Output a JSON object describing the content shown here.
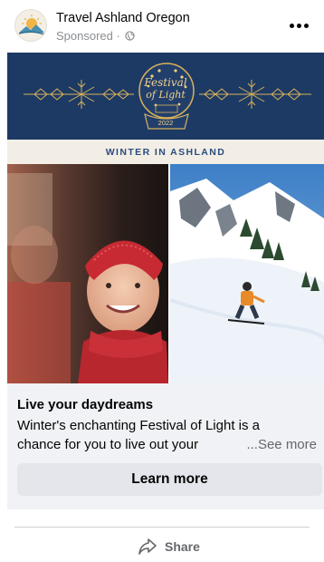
{
  "post": {
    "page_name": "Travel Ashland Oregon",
    "sponsored_label": "Sponsored ·",
    "colors": {
      "banner_navy": "#1d3a64",
      "band_cream": "#f2eee5",
      "band_text": "#2b4c7e",
      "gold": "#d9b25c"
    }
  },
  "creative": {
    "logo": {
      "line1": "Festival",
      "line2": "of Light",
      "year": "2022"
    },
    "band_text": "WINTER IN ASHLAND"
  },
  "caption": {
    "headline": "Live your daydreams",
    "desc_line1": "Winter's enchanting Festival of Light is a",
    "desc_line2": "chance for you to live out your",
    "see_more": "...See more",
    "cta": "Learn more"
  },
  "actions": {
    "share": "Share"
  }
}
